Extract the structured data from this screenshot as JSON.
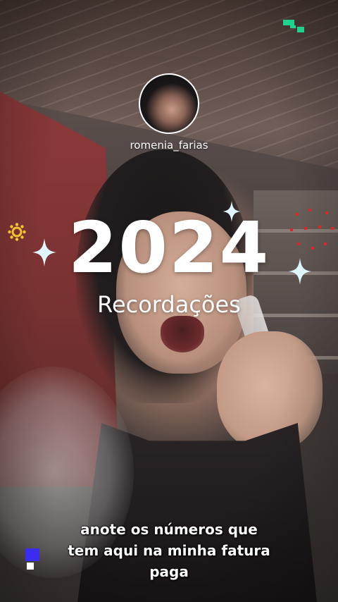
{
  "profile": {
    "username": "romenia_farias"
  },
  "headline": {
    "year": "2024",
    "subtitle": "Recordações"
  },
  "caption": {
    "lines": [
      "anote os números que",
      "tem aqui na minha fatura",
      "paga"
    ]
  },
  "decorations": {
    "sparkle_color": "#dff6ff",
    "gear_color": "#f4c430",
    "dot_color": "#e0242b",
    "logo_color": "#1fd38f",
    "block_color": "#3a2cf0"
  }
}
